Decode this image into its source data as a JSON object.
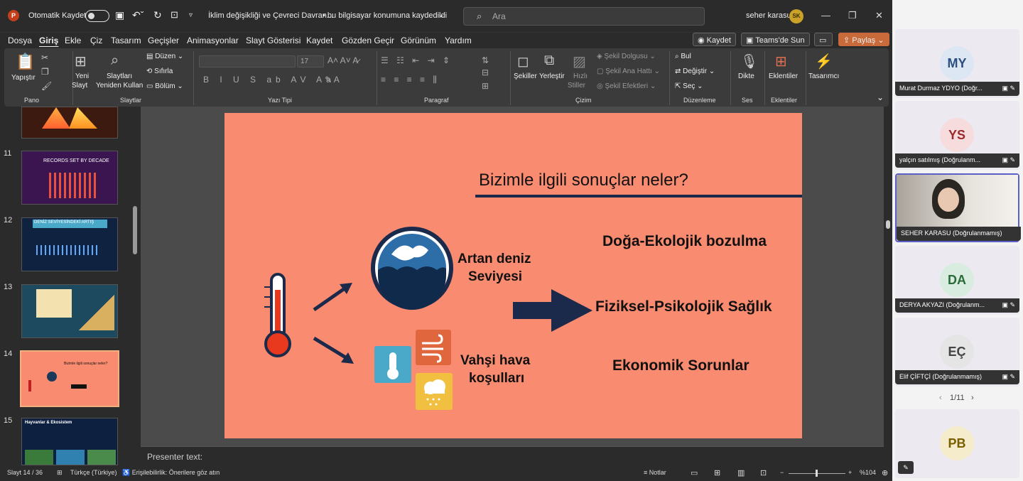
{
  "titlebar": {
    "autosave_label": "Otomatik Kaydet",
    "doc_title": "İklim değişikliği ve Çevreci Davran...",
    "save_status": "• bu bilgisayar konumuna kaydedildi",
    "search_placeholder": "Ara",
    "user_name": "seher karasu",
    "user_initials": "SK"
  },
  "menu": [
    "Dosya",
    "Giriş",
    "Ekle",
    "Çiz",
    "Tasarım",
    "Geçişler",
    "Animasyonlar",
    "Slayt Gösterisi",
    "Kaydet",
    "Gözden Geçir",
    "Görünüm",
    "Yardım"
  ],
  "menu_right": {
    "record": "Kaydet",
    "teams": "Teams'de Sun",
    "share": "Paylaş"
  },
  "ribbon": {
    "paste": "Yapıştır",
    "group_clipboard": "Pano",
    "new_slide_1": "Yeni",
    "new_slide_2": "Slayt",
    "reuse_1": "Slaytları",
    "reuse_2": "Yeniden Kullan",
    "layout": "Düzen",
    "reset": "Sıfırla",
    "section": "Bölüm",
    "group_slides": "Slaytlar",
    "font_size": "17",
    "group_font": "Yazı Tipi",
    "group_paragraph": "Paragraf",
    "shapes": "Şekiller",
    "arrange": "Yerleştir",
    "quick_styles_1": "Hızlı",
    "quick_styles_2": "Stiller",
    "shape_fill": "Şekil Dolgusu",
    "shape_outline": "Şekil Ana Hattı",
    "shape_effects": "Şekil Efektleri",
    "group_drawing": "Çizim",
    "find": "Bul",
    "replace": "Değiştir",
    "select": "Seç",
    "group_editing": "Düzenleme",
    "dictate": "Dikte",
    "group_voice": "Ses",
    "addins": "Eklentiler",
    "group_addins": "Eklentiler",
    "designer": "Tasarımcı"
  },
  "thumbnails": {
    "numbers": [
      "11",
      "12",
      "13",
      "14",
      "15"
    ],
    "t11_title": "RECORDS SET BY DECADE",
    "t12_title": "DENİZ SEVİYESİNDEKİ ARTIŞ",
    "t14_title": "Bizimle ilgili sonuçlar neler?",
    "t15_title": "Hayvanlar & Ekosistem"
  },
  "slide": {
    "title": "Bizimle ilgili sonuçlar neler?",
    "sea_1": "Artan deniz",
    "sea_2": "Seviyesi",
    "weather_1": "Vahşi hava",
    "weather_2": "koşulları",
    "c1": "Doğa-Ekolojik bozulma",
    "c2": "Fiziksel-Psikolojik Sağlık",
    "c3": "Ekonomik Sorunlar"
  },
  "notes_label": "Presenter text:",
  "status": {
    "slide": "Slayt 14 / 36",
    "lang": "Türkçe (Türkiye)",
    "access": "Erişilebilirlik: Önerilere göz atın",
    "notes": "Notlar",
    "zoom": "%104"
  },
  "participants": [
    {
      "initials": "MY",
      "name": "Murat Durmaz YDYO (Doğr...",
      "bg": "#dde6f3",
      "fg": "#2a4f80"
    },
    {
      "initials": "YS",
      "name": "yalçın satılmış (Doğrulanm...",
      "bg": "#f6dcdc",
      "fg": "#9b2a2a"
    },
    {
      "initials": "",
      "name": "SEHER KARASU (Doğrulanmamış)",
      "bg": "#cfc8c0",
      "fg": "#333"
    },
    {
      "initials": "DA",
      "name": "DERYA AKYAZI (Doğrulanm...",
      "bg": "#d8ecdf",
      "fg": "#2a6b3a"
    },
    {
      "initials": "EÇ",
      "name": "Elif ÇİFTÇİ (Doğrulanmamış)",
      "bg": "#e5e5e5",
      "fg": "#444"
    },
    {
      "initials": "PB",
      "name": "",
      "bg": "#f4eccb",
      "fg": "#7a5e00"
    }
  ],
  "pager": "1/11"
}
